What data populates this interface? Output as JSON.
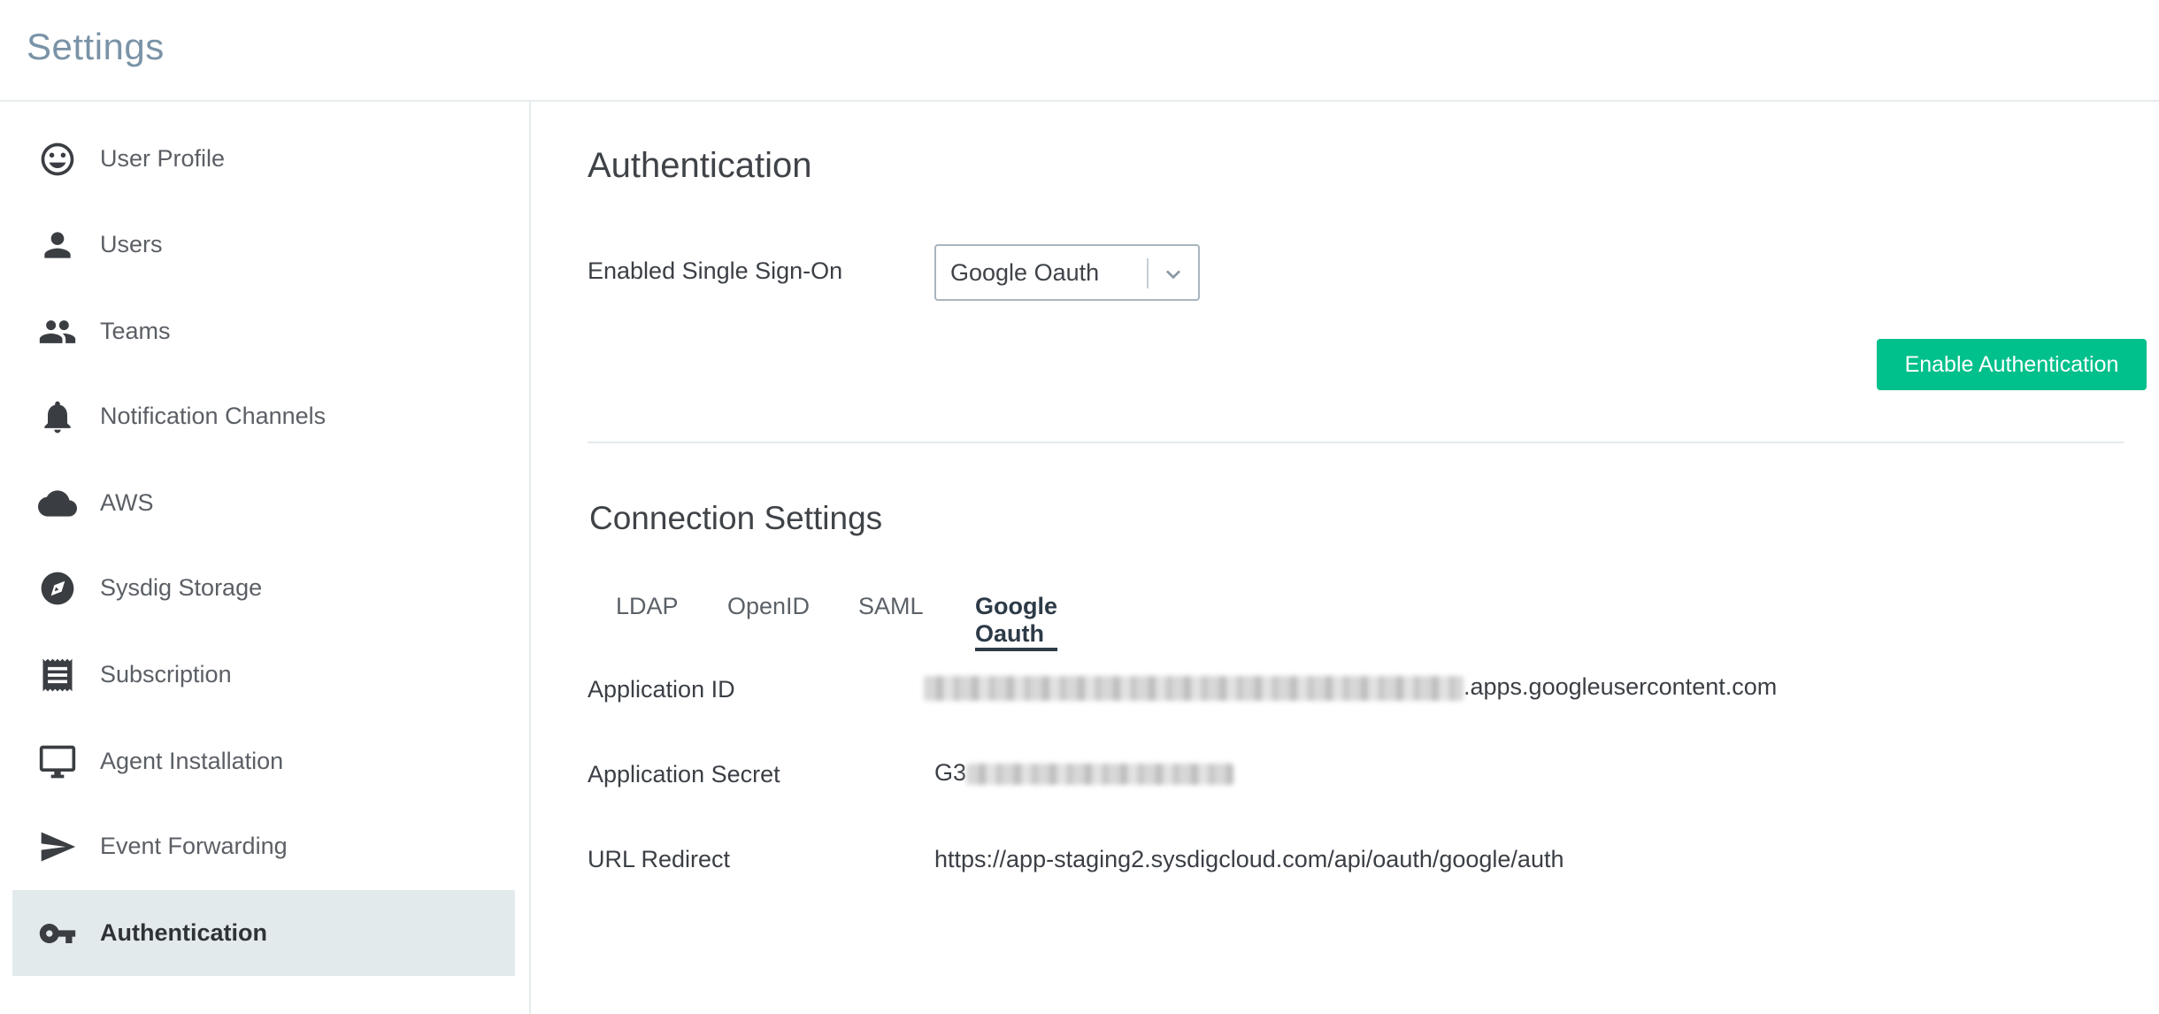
{
  "header": {
    "title": "Settings"
  },
  "sidebar": {
    "items": [
      {
        "label": "User Profile",
        "icon": "smiley-icon",
        "active": false
      },
      {
        "label": "Users",
        "icon": "person-icon",
        "active": false
      },
      {
        "label": "Teams",
        "icon": "people-icon",
        "active": false
      },
      {
        "label": "Notification Channels",
        "icon": "bell-icon",
        "active": false
      },
      {
        "label": "AWS",
        "icon": "cloud-icon",
        "active": false
      },
      {
        "label": "Sysdig Storage",
        "icon": "storage-icon",
        "active": false
      },
      {
        "label": "Subscription",
        "icon": "receipt-icon",
        "active": false
      },
      {
        "label": "Agent Installation",
        "icon": "monitor-icon",
        "active": false
      },
      {
        "label": "Event Forwarding",
        "icon": "send-icon",
        "active": false
      },
      {
        "label": "Authentication",
        "icon": "key-icon",
        "active": true
      }
    ]
  },
  "main": {
    "title": "Authentication",
    "sso": {
      "label": "Enabled Single Sign-On",
      "selected": "Google Oauth"
    },
    "enable_button": "Enable Authentication",
    "connection": {
      "title": "Connection Settings",
      "tabs": [
        {
          "label": "LDAP",
          "active": false
        },
        {
          "label": "OpenID",
          "active": false
        },
        {
          "label": "SAML",
          "active": false
        },
        {
          "label": "Google Oauth",
          "active": true
        }
      ],
      "fields": {
        "app_id": {
          "label": "Application ID",
          "value_suffix": ".apps.googleusercontent.com"
        },
        "app_secret": {
          "label": "Application Secret",
          "value_prefix": "G3"
        },
        "url_redirect": {
          "label": "URL Redirect",
          "value": "https://app-staging2.sysdigcloud.com/api/oauth/google/auth"
        }
      }
    }
  },
  "colors": {
    "accent_green": "#00c08b",
    "active_nav_bg": "#e3eaec",
    "title_blue_gray": "#7a93a7"
  }
}
